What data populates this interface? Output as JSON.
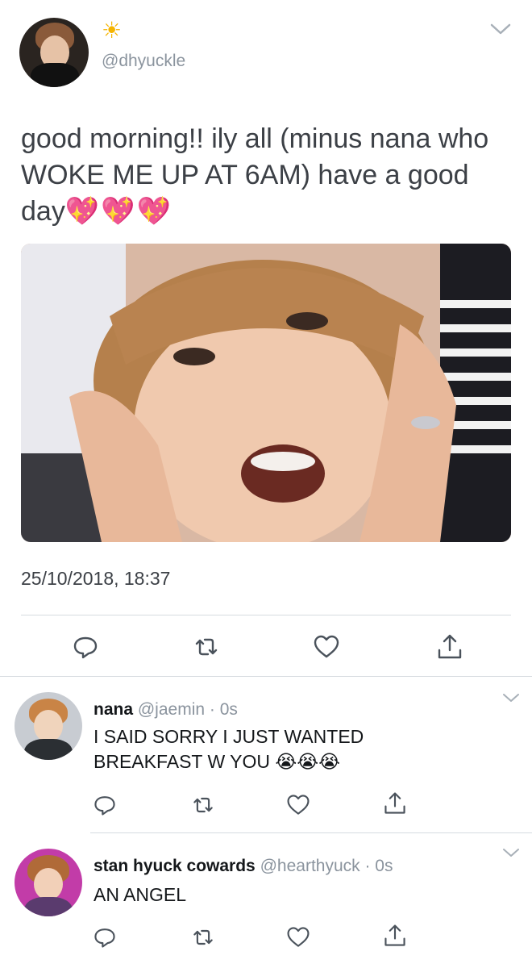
{
  "main_tweet": {
    "name_emoji": "☀",
    "handle": "@dhyuckle",
    "text": "good morning!! ily all (minus nana who WOKE ME UP AT 6AM) have a good day",
    "emojis": "💖💖💖",
    "timestamp": "25/10/2018, 18:37",
    "icons": [
      "reply-icon",
      "retweet-icon",
      "like-icon",
      "share-icon"
    ]
  },
  "replies": [
    {
      "name": "nana",
      "handle": "@jaemin",
      "time": "· 0s",
      "text": "I SAID SORRY I JUST WANTED BREAKFAST W YOU",
      "emojis": "😭😭😭"
    },
    {
      "name": "stan hyuck cowards",
      "handle": "@hearthyuck",
      "time": "· 0s",
      "text": "AN ANGEL",
      "emojis": ""
    }
  ],
  "colors": {
    "text": "#14171a",
    "muted": "#8b949e",
    "divider": "#d6dbe0",
    "sun": "#f5b400",
    "heart": "#ff5ab0"
  }
}
